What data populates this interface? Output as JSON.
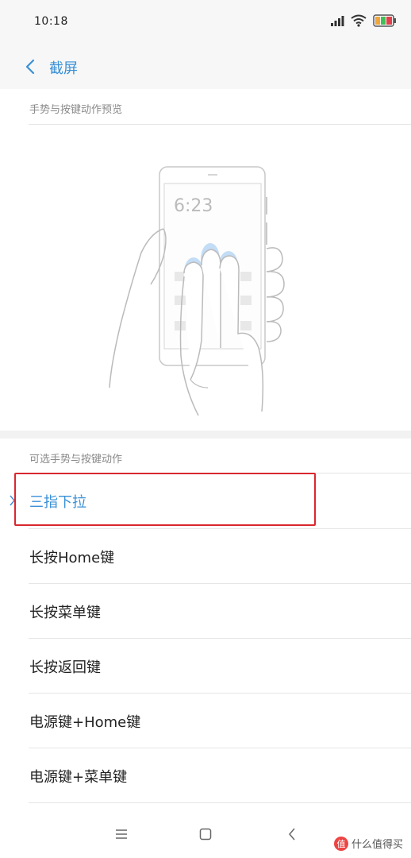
{
  "status": {
    "time": "10:18",
    "icons": [
      "signal-icon",
      "wifi-icon",
      "battery-icon"
    ]
  },
  "header": {
    "title": "截屏",
    "back_icon": "chevron-left-icon"
  },
  "preview_section": {
    "label": "手势与按键动作预览",
    "phone_clock": "6:23"
  },
  "options_section": {
    "label": "可选手势与按键动作",
    "items": [
      {
        "label": "三指下拉",
        "selected": true
      },
      {
        "label": "长按Home键",
        "selected": false
      },
      {
        "label": "长按菜单键",
        "selected": false
      },
      {
        "label": "长按返回键",
        "selected": false
      },
      {
        "label": "电源键+Home键",
        "selected": false
      },
      {
        "label": "电源键+菜单键",
        "selected": false
      }
    ]
  },
  "navbar": {
    "icons": [
      "menu-icon",
      "home-icon",
      "back-icon"
    ]
  },
  "watermark": {
    "badge": "值",
    "text": "什么值得买"
  },
  "colors": {
    "accent": "#3a90d6",
    "highlight": "#d9282f"
  }
}
